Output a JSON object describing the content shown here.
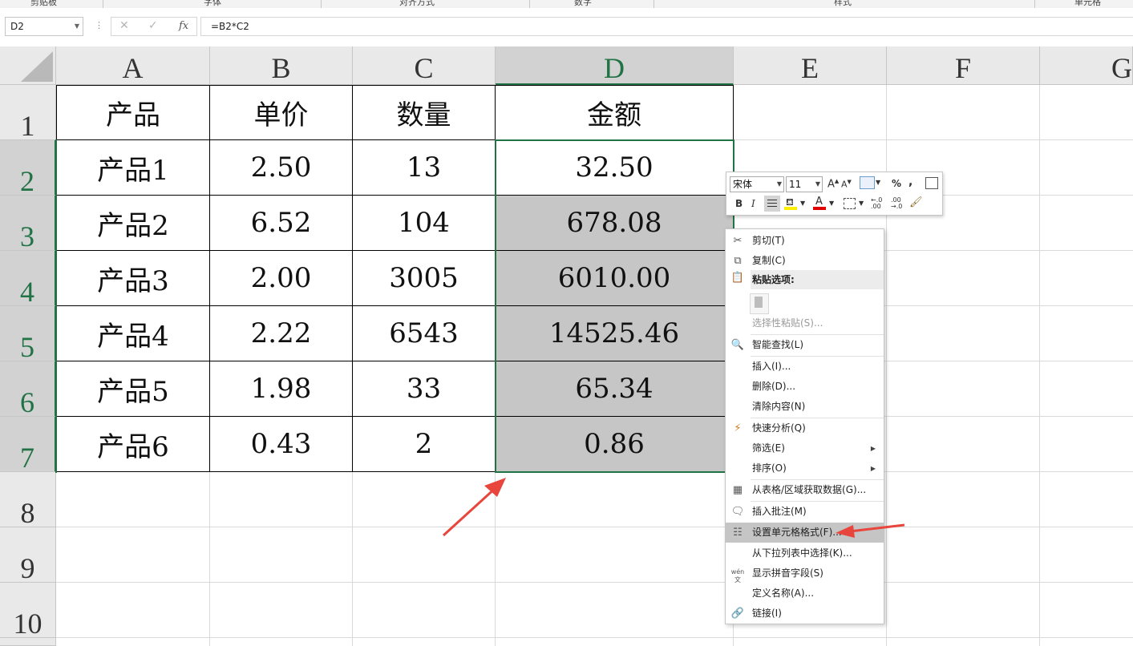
{
  "ribbon": {
    "groups": [
      "剪贴板",
      "字体",
      "对齐方式",
      "数字",
      "样式",
      "单元格"
    ]
  },
  "formula_bar": {
    "name_box": "D2",
    "dots": "⋮",
    "cancel": "✕",
    "enter": "✓",
    "fx": "fx",
    "formula": "=B2*C2"
  },
  "columns": [
    "A",
    "B",
    "C",
    "D",
    "E",
    "F",
    "G"
  ],
  "rows": [
    "1",
    "2",
    "3",
    "4",
    "5",
    "6",
    "7",
    "8",
    "9",
    "10"
  ],
  "table": [
    [
      "产品",
      "单价",
      "数量",
      "金额"
    ],
    [
      "产品1",
      "2.50",
      "13",
      "32.50"
    ],
    [
      "产品2",
      "6.52",
      "104",
      "678.08"
    ],
    [
      "产品3",
      "2.00",
      "3005",
      "6010.00"
    ],
    [
      "产品4",
      "2.22",
      "6543",
      "14525.46"
    ],
    [
      "产品5",
      "1.98",
      "33",
      "65.34"
    ],
    [
      "产品6",
      "0.43",
      "2",
      "0.86"
    ]
  ],
  "mini_toolbar": {
    "font": "宋体",
    "size": "11",
    "grow_font": "A",
    "shrink_font": "A",
    "percent": "%",
    "comma": ",",
    "bold": "B",
    "italic": "I",
    "font_color_letter": "A",
    "inc_decimal": ".00",
    "dec_decimal": ".0"
  },
  "context_menu": {
    "cut": "剪切(T)",
    "copy": "复制(C)",
    "paste_options": "粘贴选项:",
    "paste_special": "选择性粘贴(S)...",
    "smart_lookup": "智能查找(L)",
    "insert": "插入(I)...",
    "delete": "删除(D)...",
    "clear": "清除内容(N)",
    "quick_analysis": "快速分析(Q)",
    "filter": "筛选(E)",
    "sort": "排序(O)",
    "get_data": "从表格/区域获取数据(G)...",
    "insert_comment": "插入批注(M)",
    "format_cells": "设置单元格格式(F)...",
    "pick_list": "从下拉列表中选择(K)...",
    "phonetic": "显示拼音字段(S)",
    "define_name": "定义名称(A)...",
    "link": "链接(I)",
    "wen_icon": "wén 文"
  },
  "colors": {
    "selection": "#217346",
    "highlight_fill": "#c6c6c6",
    "arrow": "#e8453c"
  }
}
